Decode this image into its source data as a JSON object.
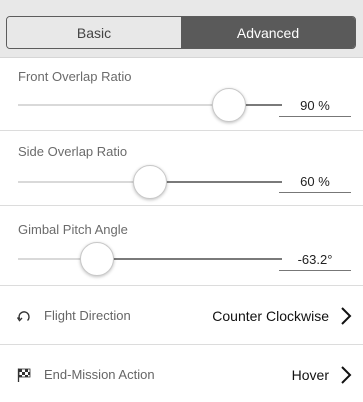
{
  "tabs": {
    "basic": "Basic",
    "advanced": "Advanced",
    "selected": "Advanced"
  },
  "front_overlap": {
    "title": "Front Overlap Ratio",
    "value": "90 %",
    "level": 0.8
  },
  "side_overlap": {
    "title": "Side Overlap Ratio",
    "value": "60 %",
    "level": 0.5
  },
  "gimbal_pitch": {
    "title": "Gimbal Pitch Angle",
    "value": "-63.2°",
    "level": 0.3
  },
  "flight_direction": {
    "label": "Flight Direction",
    "value": "Counter Clockwise",
    "icon": "rotate-icon"
  },
  "end_mission": {
    "label": "End-Mission Action",
    "value": "Hover",
    "icon": "checkered-flag-icon"
  },
  "colors": {
    "segment_active": "#5a5a5a",
    "segment_inactive": "#e8e8e8",
    "track_active": "#7a7a7a",
    "track_inactive": "#d9d9d9"
  }
}
